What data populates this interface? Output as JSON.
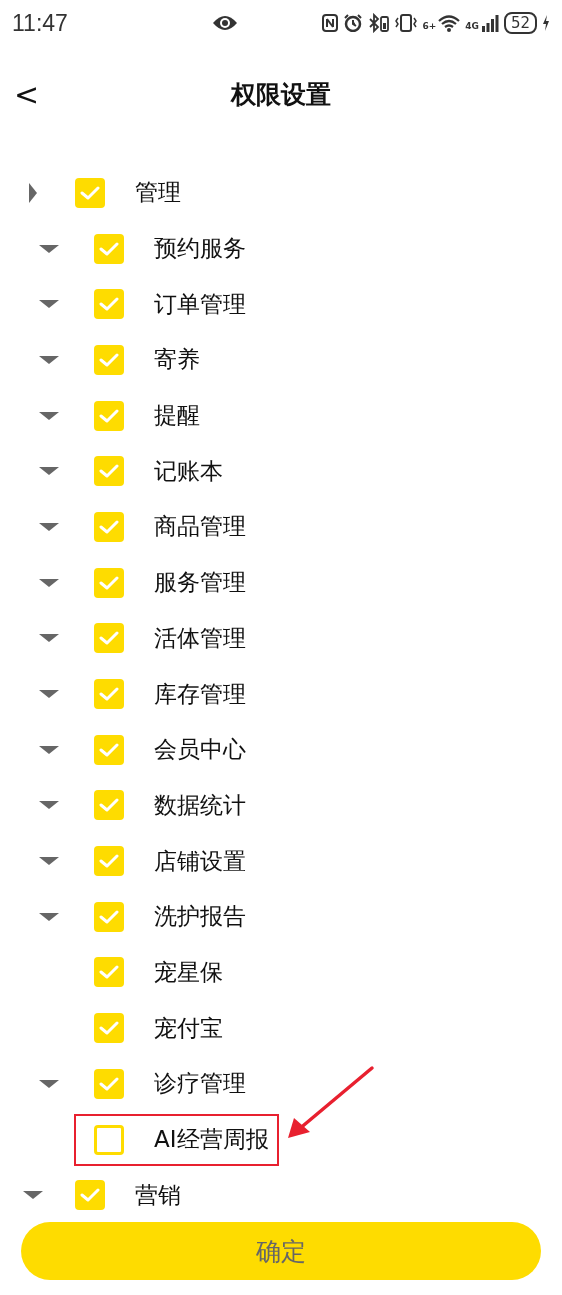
{
  "status_bar": {
    "time": "11:47",
    "wifi_tag": "6+",
    "network": "4G",
    "battery": "52"
  },
  "header": {
    "back": "<",
    "title": "权限设置"
  },
  "tree": [
    {
      "label": "管理",
      "checked": true,
      "expanded": false,
      "children": [
        {
          "label": "预约服务",
          "checked": true,
          "expanded": true
        },
        {
          "label": "订单管理",
          "checked": true,
          "expanded": true
        },
        {
          "label": "寄养",
          "checked": true,
          "expanded": true
        },
        {
          "label": "提醒",
          "checked": true,
          "expanded": true
        },
        {
          "label": "记账本",
          "checked": true,
          "expanded": true
        },
        {
          "label": "商品管理",
          "checked": true,
          "expanded": true
        },
        {
          "label": "服务管理",
          "checked": true,
          "expanded": true
        },
        {
          "label": "活体管理",
          "checked": true,
          "expanded": true
        },
        {
          "label": "库存管理",
          "checked": true,
          "expanded": true
        },
        {
          "label": "会员中心",
          "checked": true,
          "expanded": true
        },
        {
          "label": "数据统计",
          "checked": true,
          "expanded": true
        },
        {
          "label": "店铺设置",
          "checked": true,
          "expanded": true
        },
        {
          "label": "洗护报告",
          "checked": true,
          "expanded": true
        },
        {
          "label": "宠星保",
          "checked": true
        },
        {
          "label": "宠付宝",
          "checked": true
        },
        {
          "label": "诊疗管理",
          "checked": true,
          "expanded": true
        },
        {
          "label": "AI经营周报",
          "checked": false,
          "highlighted": true
        }
      ]
    },
    {
      "label": "营销",
      "checked": true,
      "expanded": true
    }
  ],
  "confirm_button": "确定"
}
